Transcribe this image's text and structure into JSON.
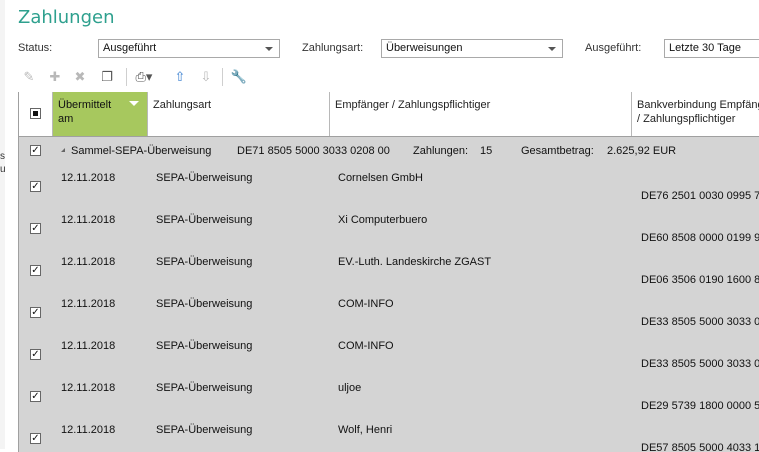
{
  "window": {
    "title": "Zahlungen"
  },
  "filters": {
    "status_label": "Status:",
    "status_value": "Ausgeführt",
    "type_label": "Zahlungsart:",
    "type_value": "Überweisungen",
    "executed_label": "Ausgeführt:",
    "executed_value": "Letzte 30 Tage"
  },
  "toolbar": {
    "icons": [
      "pencil-icon",
      "plus-icon",
      "delete-icon",
      "copy-icon",
      "print-icon",
      "arrow-up-icon",
      "arrow-down-icon",
      "wrench-icon"
    ]
  },
  "table": {
    "columns": [
      "Übermittelt am",
      "Zahlungsart",
      "Empfänger / Zahlungspflichtiger",
      "Bankverbindung Empfänger / Zahlungspflichtiger"
    ],
    "group": {
      "name": "Sammel-SEPA-Überweisung",
      "iban": "DE71 8505 5000 3033 0208 00",
      "count_label": "Zahlungen:",
      "count": "15",
      "total_label": "Gesamtbetrag:",
      "total": "2.625,92 EUR"
    },
    "rows": [
      {
        "date": "12.11.2018",
        "type": "SEPA-Überweisung",
        "recipient": "Cornelsen GmbH",
        "iban": "DE76 2501 0030 0995 7"
      },
      {
        "date": "12.11.2018",
        "type": "SEPA-Überweisung",
        "recipient": "Xi Computerbuero",
        "iban": "DE60 8508 0000 0199 9"
      },
      {
        "date": "12.11.2018",
        "type": "SEPA-Überweisung",
        "recipient": "EV.-Luth. Landeskirche ZGAST",
        "iban": "DE06 3506 0190 1600 8"
      },
      {
        "date": "12.11.2018",
        "type": "SEPA-Überweisung",
        "recipient": "COM-INFO",
        "iban": "DE33 8505 5000 3033 0"
      },
      {
        "date": "12.11.2018",
        "type": "SEPA-Überweisung",
        "recipient": "COM-INFO",
        "iban": "DE33 8505 5000 3033 0"
      },
      {
        "date": "12.11.2018",
        "type": "SEPA-Überweisung",
        "recipient": "uljoe",
        "iban": "DE29 5739 1800 0000 5"
      },
      {
        "date": "12.11.2018",
        "type": "SEPA-Überweisung",
        "recipient": "Wolf, Henri",
        "iban": "DE57 8505 5000 4033 1"
      }
    ]
  },
  "colors": {
    "title": "#2ea08e",
    "sorted_header": "#a7c85e",
    "grid_bg": "#d4d4d4"
  }
}
